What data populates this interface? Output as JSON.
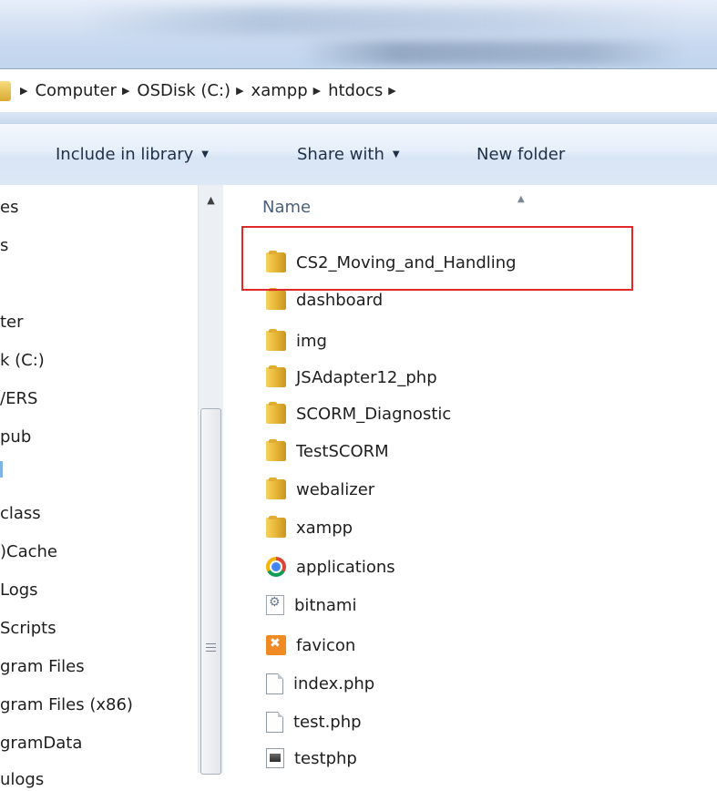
{
  "address": {
    "crumbs": [
      "Computer",
      "OSDisk (C:)",
      "xampp",
      "htdocs"
    ]
  },
  "toolbar": {
    "include_label": "Include in library",
    "share_label": "Share with",
    "newfolder_label": "New folder"
  },
  "nav": {
    "items": [
      "es",
      "s",
      "ter",
      "k (C:)",
      "/ERS",
      "pub",
      "class",
      ")Cache",
      "Logs",
      "Scripts",
      "gram Files",
      "gram Files (x86)",
      "gramData",
      "ulogs"
    ]
  },
  "filelist": {
    "header": "Name",
    "files": [
      {
        "name": "CS2_Moving_and_Handling",
        "icon": "folder-icon"
      },
      {
        "name": "dashboard",
        "icon": "folder-icon"
      },
      {
        "name": "img",
        "icon": "folder-icon"
      },
      {
        "name": "JSAdapter12_php",
        "icon": "folder-icon"
      },
      {
        "name": "SCORM_Diagnostic",
        "icon": "folder-icon"
      },
      {
        "name": "TestSCORM",
        "icon": "folder-icon"
      },
      {
        "name": "webalizer",
        "icon": "folder-icon"
      },
      {
        "name": "xampp",
        "icon": "folder-icon"
      },
      {
        "name": "applications",
        "icon": "chrome-icon"
      },
      {
        "name": "bitnami",
        "icon": "settings-file-icon"
      },
      {
        "name": "favicon",
        "icon": "xampp-icon"
      },
      {
        "name": "index.php",
        "icon": "document-icon"
      },
      {
        "name": "test.php",
        "icon": "document-icon"
      },
      {
        "name": "testphp",
        "icon": "image-file-icon"
      }
    ]
  },
  "colors": {
    "highlight": "#e0292a",
    "folder": "#e8b93a",
    "toolbar_text": "#1e3047"
  }
}
